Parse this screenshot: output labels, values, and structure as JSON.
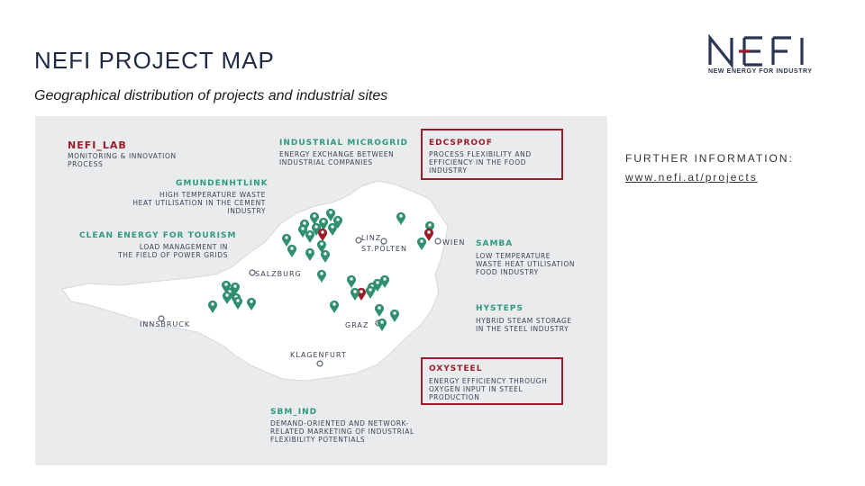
{
  "header": {
    "title": "NEFI PROJECT MAP",
    "subtitle": "Geographical distribution of projects and industrial sites"
  },
  "logo": {
    "wordmark": "NEFI",
    "tagline": "NEW ENERGY FOR INDUSTRY",
    "color": "#2b3552",
    "accent": "#9b1c2a"
  },
  "info": {
    "heading": "FURTHER INFORMATION:",
    "link": "www.nefi.at/projects"
  },
  "map": {
    "colors": {
      "land": "#ffffff",
      "panel": "#e9ebed",
      "pin_green": "#2f8f6f",
      "pin_red": "#9b1c2a",
      "highlight": "#9b1c2a"
    },
    "cities": {
      "linz": "LINZ",
      "st_poelten": "ST.PÖLTEN",
      "wien": "WIEN",
      "salzburg": "SALZBURG",
      "innsbruck": "INNSBRUCK",
      "graz": "GRAZ",
      "klagenfurt": "KLAGENFURT"
    },
    "projects": {
      "nefi_lab": {
        "name": "NEFI_LAB",
        "desc": "MONITORING & INNOVATION\nPROCESS"
      },
      "industrial_microgrid": {
        "name": "INDUSTRIAL MICROGRID",
        "desc": "ENERGY EXCHANGE BETWEEN\nINDUSTRIAL COMPANIES"
      },
      "edcsproof": {
        "name": "EDCSPROOF",
        "desc": "PROCESS FLEXIBILITY AND\nEFFICIENCY IN THE FOOD\nINDUSTRY"
      },
      "gmundenhtlink": {
        "name": "GMUNDENHTLINK",
        "desc": "HIGH TEMPERATURE WASTE\nHEAT UTILISATION IN THE CEMENT\nINDUSTRY"
      },
      "clean_energy": {
        "name": "CLEAN ENERGY FOR TOURISM",
        "desc": "LOAD MANAGEMENT IN\nTHE FIELD OF POWER GRIDS"
      },
      "samba": {
        "name": "SAMBA",
        "desc": "LOW TEMPERATURE\nWASTE HEAT UTILISATION\nFOOD INDUSTRY"
      },
      "hysteps": {
        "name": "HYSTEPS",
        "desc": "HYBRID STEAM STORAGE\nIN THE STEEL INDUSTRY"
      },
      "oxysteel": {
        "name": "OXYSTEEL",
        "desc": "ENERGY EFFICIENCY THROUGH\nOXYGEN INPUT IN STEEL\nPRODUCTION"
      },
      "sbm_ind": {
        "name": "SBM_IND",
        "desc": "DEMAND-ORIENTED AND NETWORK-\nRELATED MARKETING OF INDUSTRIAL\nFLEXIBILITY POTENTIALS"
      }
    }
  }
}
